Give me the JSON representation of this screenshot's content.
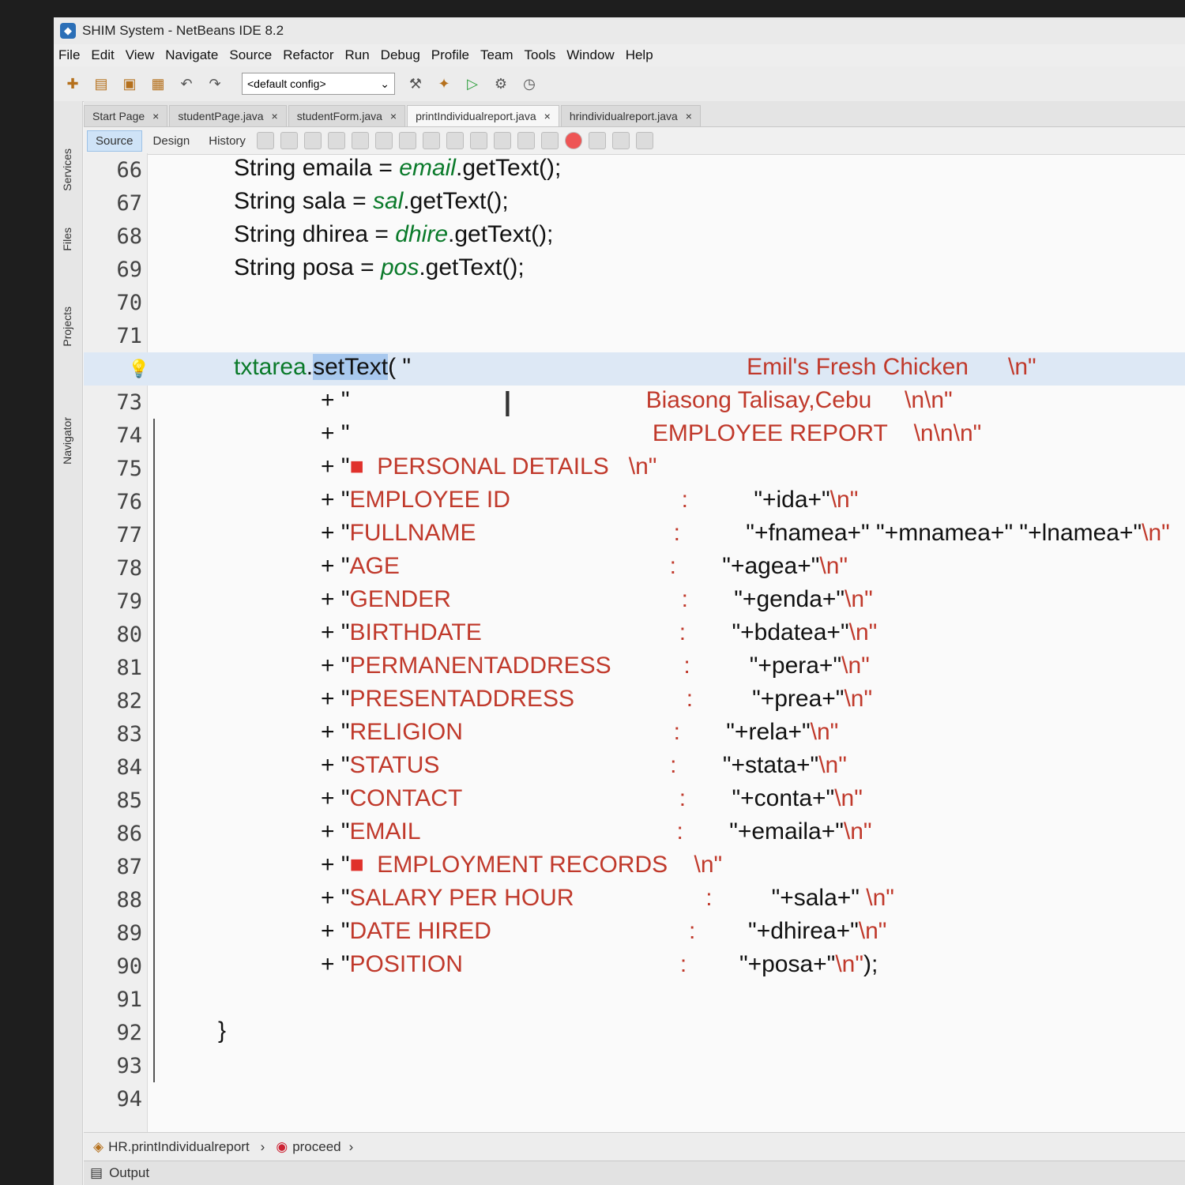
{
  "window": {
    "title": "SHIM System - NetBeans IDE 8.2"
  },
  "menu": [
    "File",
    "Edit",
    "View",
    "Navigate",
    "Source",
    "Refactor",
    "Run",
    "Debug",
    "Profile",
    "Team",
    "Tools",
    "Window",
    "Help"
  ],
  "toolbar": {
    "config": "<default config>"
  },
  "side_panels": [
    "Services",
    "Files",
    "Projects",
    "Navigator"
  ],
  "tabs": [
    "Start Page",
    "studentPage.java",
    "studentForm.java",
    "printIndividualreport.java",
    "hrindividualreport.java"
  ],
  "subtabs": [
    "Source",
    "Design",
    "History"
  ],
  "code_lines": [
    {
      "n": "66",
      "parts": [
        {
          "t": "String emaila = "
        },
        {
          "t": "email",
          "c": "fld"
        },
        {
          "t": ".getText();"
        }
      ]
    },
    {
      "n": "67",
      "parts": [
        {
          "t": "String sala = "
        },
        {
          "t": "sal",
          "c": "fld"
        },
        {
          "t": ".getText();"
        }
      ]
    },
    {
      "n": "68",
      "parts": [
        {
          "t": "String dhirea = "
        },
        {
          "t": "dhire",
          "c": "fld"
        },
        {
          "t": ".getText();"
        }
      ]
    },
    {
      "n": "69",
      "parts": [
        {
          "t": "String posa = "
        },
        {
          "t": "pos",
          "c": "fld"
        },
        {
          "t": ".getText();"
        }
      ]
    },
    {
      "n": "70",
      "parts": []
    },
    {
      "n": "71",
      "parts": []
    },
    {
      "n": "",
      "bulb": true,
      "hl": true,
      "parts": [
        {
          "t": "txtarea",
          "c": "obj"
        },
        {
          "t": "."
        },
        {
          "t": "setText",
          "c": "sel"
        },
        {
          "t": "( \"                                                   "
        },
        {
          "t": "Emil's Fresh Chicken      \\n\"",
          "c": "str"
        }
      ]
    },
    {
      "n": "73",
      "indent": true,
      "parts": [
        {
          "t": "+ \"                                             "
        },
        {
          "t": "Biasong Talisay,Cebu     \\n\\n\"",
          "c": "str"
        }
      ]
    },
    {
      "n": "74",
      "indent": true,
      "parts": [
        {
          "t": "+ \"                                              "
        },
        {
          "t": "EMPLOYEE REPORT    \\n\\n\\n\"",
          "c": "str"
        }
      ]
    },
    {
      "n": "75",
      "indent": true,
      "parts": [
        {
          "t": "+ \""
        },
        {
          "t": "■",
          "c": "mark"
        },
        {
          "t": "  PERSONAL DETAILS   \\n\"",
          "c": "str"
        }
      ]
    },
    {
      "n": "76",
      "indent": true,
      "parts": [
        {
          "t": "+ \""
        },
        {
          "t": "EMPLOYEE ID                          :          ",
          "c": "str"
        },
        {
          "t": "\"+ida+\""
        },
        {
          "t": "\\n\"",
          "c": "str"
        }
      ]
    },
    {
      "n": "77",
      "indent": true,
      "parts": [
        {
          "t": "+ \""
        },
        {
          "t": "FULLNAME                              :          ",
          "c": "str"
        },
        {
          "t": "\"+fnamea+\" \"+mnamea+\" \"+lnamea+\""
        },
        {
          "t": "\\n\"",
          "c": "str"
        }
      ]
    },
    {
      "n": "78",
      "indent": true,
      "parts": [
        {
          "t": "+ \""
        },
        {
          "t": "AGE                                         :       ",
          "c": "str"
        },
        {
          "t": "\"+agea+\""
        },
        {
          "t": "\\n\"",
          "c": "str"
        }
      ]
    },
    {
      "n": "79",
      "indent": true,
      "parts": [
        {
          "t": "+ \""
        },
        {
          "t": "GENDER                                   :       ",
          "c": "str"
        },
        {
          "t": "\"+genda+\""
        },
        {
          "t": "\\n\"",
          "c": "str"
        }
      ]
    },
    {
      "n": "80",
      "indent": true,
      "parts": [
        {
          "t": "+ \""
        },
        {
          "t": "BIRTHDATE                              :       ",
          "c": "str"
        },
        {
          "t": "\"+bdatea+\""
        },
        {
          "t": "\\n\"",
          "c": "str"
        }
      ]
    },
    {
      "n": "81",
      "indent": true,
      "parts": [
        {
          "t": "+ \""
        },
        {
          "t": "PERMANENTADDRESS           :         ",
          "c": "str"
        },
        {
          "t": "\"+pera+\""
        },
        {
          "t": "\\n\"",
          "c": "str"
        }
      ]
    },
    {
      "n": "82",
      "indent": true,
      "parts": [
        {
          "t": "+ \""
        },
        {
          "t": "PRESENTADDRESS                 :         ",
          "c": "str"
        },
        {
          "t": "\"+prea+\""
        },
        {
          "t": "\\n\"",
          "c": "str"
        }
      ]
    },
    {
      "n": "83",
      "indent": true,
      "parts": [
        {
          "t": "+ \""
        },
        {
          "t": "RELIGION                                :       ",
          "c": "str"
        },
        {
          "t": "\"+rela+\""
        },
        {
          "t": "\\n\"",
          "c": "str"
        }
      ]
    },
    {
      "n": "84",
      "indent": true,
      "parts": [
        {
          "t": "+ \""
        },
        {
          "t": "STATUS                                   :       ",
          "c": "str"
        },
        {
          "t": "\"+stata+\""
        },
        {
          "t": "\\n\"",
          "c": "str"
        }
      ]
    },
    {
      "n": "85",
      "indent": true,
      "parts": [
        {
          "t": "+ \""
        },
        {
          "t": "CONTACT                                 :       ",
          "c": "str"
        },
        {
          "t": "\"+conta+\""
        },
        {
          "t": "\\n\"",
          "c": "str"
        }
      ]
    },
    {
      "n": "86",
      "indent": true,
      "parts": [
        {
          "t": "+ \""
        },
        {
          "t": "EMAIL                                       :       ",
          "c": "str"
        },
        {
          "t": "\"+emaila+\""
        },
        {
          "t": "\\n\"",
          "c": "str"
        }
      ]
    },
    {
      "n": "87",
      "indent": true,
      "parts": [
        {
          "t": "+ \""
        },
        {
          "t": "■",
          "c": "mark"
        },
        {
          "t": "  EMPLOYMENT RECORDS    \\n\"",
          "c": "str"
        }
      ]
    },
    {
      "n": "88",
      "indent": true,
      "parts": [
        {
          "t": "+ \""
        },
        {
          "t": "SALARY PER HOUR                    :         ",
          "c": "str"
        },
        {
          "t": "\"+sala+\" "
        },
        {
          "t": "\\n\"",
          "c": "str"
        }
      ]
    },
    {
      "n": "89",
      "indent": true,
      "parts": [
        {
          "t": "+ \""
        },
        {
          "t": "DATE HIRED                              :        ",
          "c": "str"
        },
        {
          "t": "\"+dhirea+\""
        },
        {
          "t": "\\n\"",
          "c": "str"
        }
      ]
    },
    {
      "n": "90",
      "indent": true,
      "parts": [
        {
          "t": "+ \""
        },
        {
          "t": "POSITION                                 :        ",
          "c": "str"
        },
        {
          "t": "\"+posa+\""
        },
        {
          "t": "\\n\"",
          "c": "str"
        },
        {
          "t": ");"
        }
      ]
    },
    {
      "n": "91",
      "parts": []
    },
    {
      "n": "92",
      "brace": true,
      "parts": [
        {
          "t": "}"
        }
      ]
    },
    {
      "n": "93",
      "parts": []
    },
    {
      "n": "94",
      "parts": []
    }
  ],
  "status": {
    "class_crumb": "HR.printIndividualreport",
    "method_crumb": "proceed"
  },
  "output": {
    "label": "Output"
  }
}
